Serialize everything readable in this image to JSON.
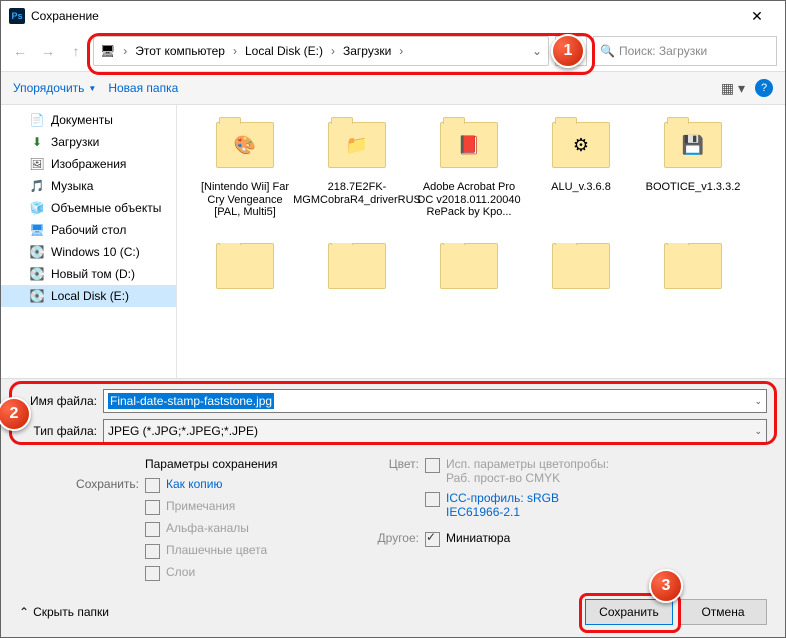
{
  "title": "Сохранение",
  "breadcrumb": [
    "Этот компьютер",
    "Local Disk (E:)",
    "Загрузки"
  ],
  "search_placeholder": "Поиск: Загрузки",
  "toolbar": {
    "organize": "Упорядочить",
    "newfolder": "Новая папка"
  },
  "sidebar": [
    {
      "icon": "📄",
      "label": "Документы"
    },
    {
      "icon": "⬇",
      "label": "Загрузки",
      "iconColor": "#2e7d32"
    },
    {
      "icon": "🖼",
      "label": "Изображения"
    },
    {
      "icon": "🎵",
      "label": "Музыка",
      "iconColor": "#1e88e5"
    },
    {
      "icon": "🧊",
      "label": "Объемные объекты"
    },
    {
      "icon": "🖥",
      "label": "Рабочий стол",
      "iconColor": "#1e88e5"
    },
    {
      "icon": "💽",
      "label": "Windows 10 (C:)"
    },
    {
      "icon": "💽",
      "label": "Новый том (D:)"
    },
    {
      "icon": "💽",
      "label": "Local Disk (E:)",
      "sel": true
    }
  ],
  "files": [
    {
      "label": "[Nintendo Wii] Far Cry Vengeance [PAL, Multi5]",
      "inner": "🎨"
    },
    {
      "label": "218.7E2FK-MGMCobraR4_driverRUS",
      "inner": "📁"
    },
    {
      "label": "Adobe Acrobat Pro DC v2018.011.20040 RePack by Kpo...",
      "inner": "📕"
    },
    {
      "label": "ALU_v.3.6.8",
      "inner": "⚙"
    },
    {
      "label": "BOOTICE_v1.3.3.2",
      "inner": "💾"
    }
  ],
  "filename_label": "Имя файла:",
  "filename_value": "Final-date-stamp-faststone.jpg",
  "filetype_label": "Тип файла:",
  "filetype_value": "JPEG (*.JPG;*.JPEG;*.JPE)",
  "params": {
    "title": "Параметры сохранения",
    "save_lbl": "Сохранить:",
    "as_copy": "Как копию",
    "notes": "Примечания",
    "alpha": "Альфа-каналы",
    "spot": "Плашечные цвета",
    "layers": "Слои",
    "color_lbl": "Цвет:",
    "proof": "Исп. параметры цветопробы:  Раб. прост-во CMYK",
    "icc": "ICC-профиль: sRGB IEC61966-2.1",
    "other_lbl": "Другое:",
    "thumb": "Миниатюра"
  },
  "hide_folders": "Скрыть папки",
  "btn_save": "Сохранить",
  "btn_cancel": "Отмена",
  "callouts": {
    "1": "1",
    "2": "2",
    "3": "3"
  }
}
